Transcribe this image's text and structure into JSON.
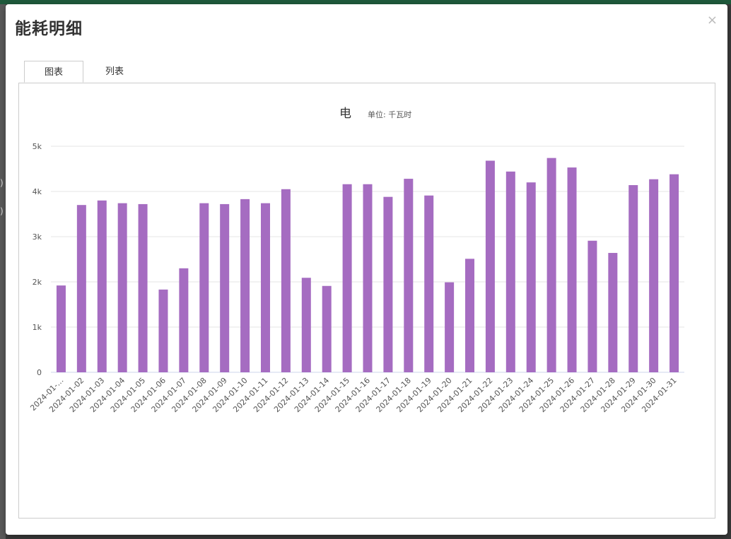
{
  "modal": {
    "title": "能耗明细",
    "close_symbol": "×"
  },
  "tabs": [
    {
      "label": "图表",
      "active": true
    },
    {
      "label": "列表",
      "active": false
    }
  ],
  "background_fragments": [
    "(",
    ")"
  ],
  "colors": {
    "bar": "#a56cc1",
    "grid": "#e6e6e6",
    "header_bar": "#1f5a3c"
  },
  "chart_data": {
    "type": "bar",
    "title": "电",
    "subtitle": "单位: 千瓦时",
    "xlabel": "",
    "ylabel": "",
    "ylim": [
      0,
      5000
    ],
    "yticks": [
      0,
      1000,
      2000,
      3000,
      4000,
      5000
    ],
    "ytick_labels": [
      "0",
      "1k",
      "2k",
      "3k",
      "4k",
      "5k"
    ],
    "grid": true,
    "categories": [
      "2024-01-…",
      "2024-01-02",
      "2024-01-03",
      "2024-01-04",
      "2024-01-05",
      "2024-01-06",
      "2024-01-07",
      "2024-01-08",
      "2024-01-09",
      "2024-01-10",
      "2024-01-11",
      "2024-01-12",
      "2024-01-13",
      "2024-01-14",
      "2024-01-15",
      "2024-01-16",
      "2024-01-17",
      "2024-01-18",
      "2024-01-19",
      "2024-01-20",
      "2024-01-21",
      "2024-01-22",
      "2024-01-23",
      "2024-01-24",
      "2024-01-25",
      "2024-01-26",
      "2024-01-27",
      "2024-01-28",
      "2024-01-29",
      "2024-01-30",
      "2024-01-31"
    ],
    "values": [
      1920,
      3700,
      3800,
      3740,
      3720,
      1830,
      2300,
      3740,
      3720,
      3830,
      3740,
      4050,
      2090,
      1910,
      4160,
      4160,
      3880,
      4280,
      3910,
      1990,
      2510,
      4680,
      4440,
      4200,
      4740,
      4530,
      2910,
      2640,
      4140,
      4270,
      4380
    ]
  }
}
